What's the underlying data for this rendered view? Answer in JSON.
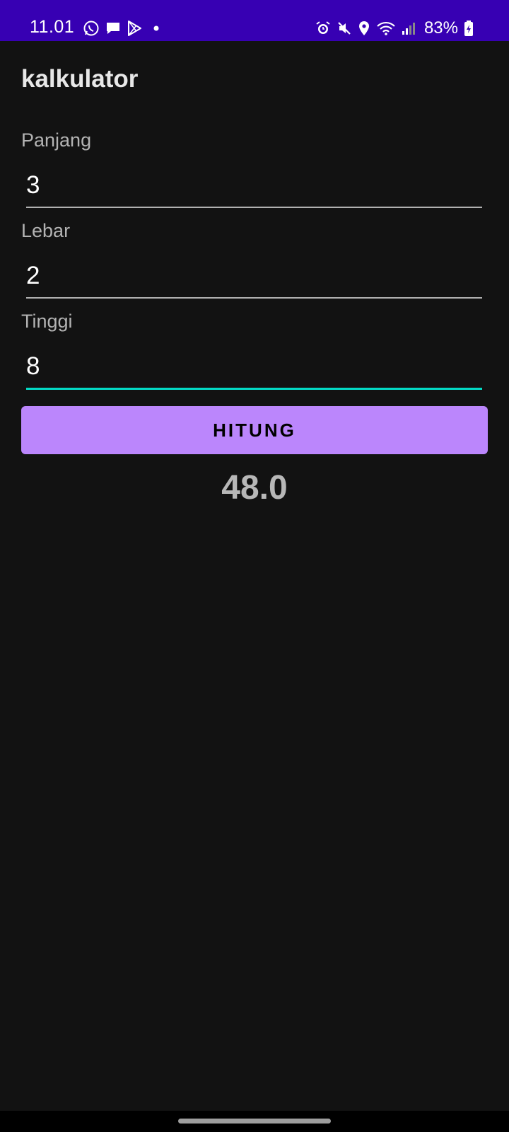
{
  "status_bar": {
    "time": "11.01",
    "battery": "83%",
    "left_icons": [
      "whatsapp-icon",
      "message-icon",
      "play-store-icon",
      "dot-icon"
    ],
    "right_icons": [
      "alarm-icon",
      "mute-icon",
      "location-icon",
      "wifi-icon",
      "signal-icon",
      "battery-icon"
    ],
    "background": "#3700b3"
  },
  "app_bar": {
    "title": "kalkulator"
  },
  "form": {
    "panjang": {
      "label": "Panjang",
      "value": "3"
    },
    "lebar": {
      "label": "Lebar",
      "value": "2"
    },
    "tinggi": {
      "label": "Tinggi",
      "value": "8"
    },
    "button_label": "HITUNG",
    "result": "48.0"
  },
  "colors": {
    "background": "#121212",
    "button": "#bb86fc",
    "focus_underline": "#03dac5"
  }
}
